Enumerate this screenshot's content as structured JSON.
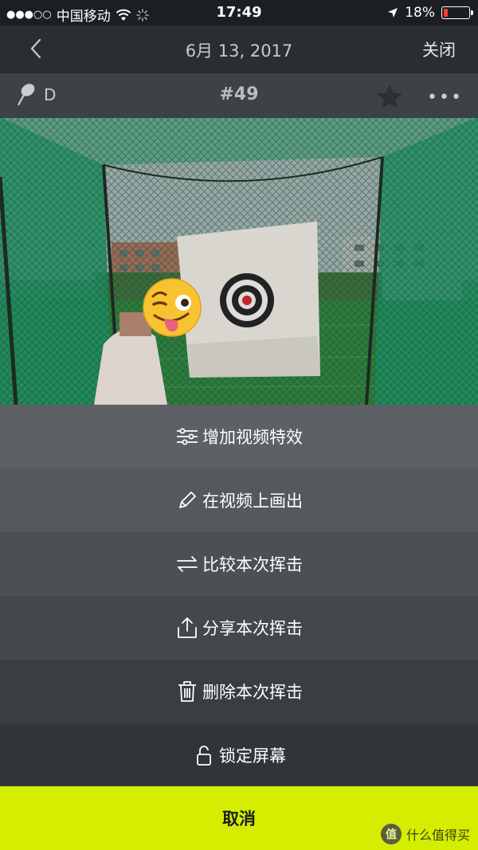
{
  "status_bar": {
    "signal": "●●●○○",
    "carrier": "中国移动",
    "time": "17:49",
    "battery_percent": "18%",
    "battery_level": 0.18
  },
  "nav": {
    "date": "6月 13, 2017",
    "close_label": "关闭"
  },
  "video": {
    "club_grade": "D",
    "shot_number": "#49"
  },
  "sheet": {
    "items": [
      {
        "label": "增加视频特效",
        "icon": "sliders-icon"
      },
      {
        "label": "在视频上画出",
        "icon": "pencil-icon"
      },
      {
        "label": "比较本次挥击",
        "icon": "swap-arrows-icon"
      },
      {
        "label": "分享本次挥击",
        "icon": "share-icon"
      },
      {
        "label": "删除本次挥击",
        "icon": "trash-icon"
      },
      {
        "label": "锁定屏幕",
        "icon": "unlock-icon"
      }
    ],
    "cancel_label": "取消"
  },
  "watermark": {
    "badge": "值",
    "text": "什么值得买"
  },
  "colors": {
    "accent": "#d4ed00",
    "sheet_rows": [
      "#5d6064",
      "#55585c",
      "#4c4f53",
      "#44474b",
      "#3a3d41",
      "#313438"
    ]
  }
}
